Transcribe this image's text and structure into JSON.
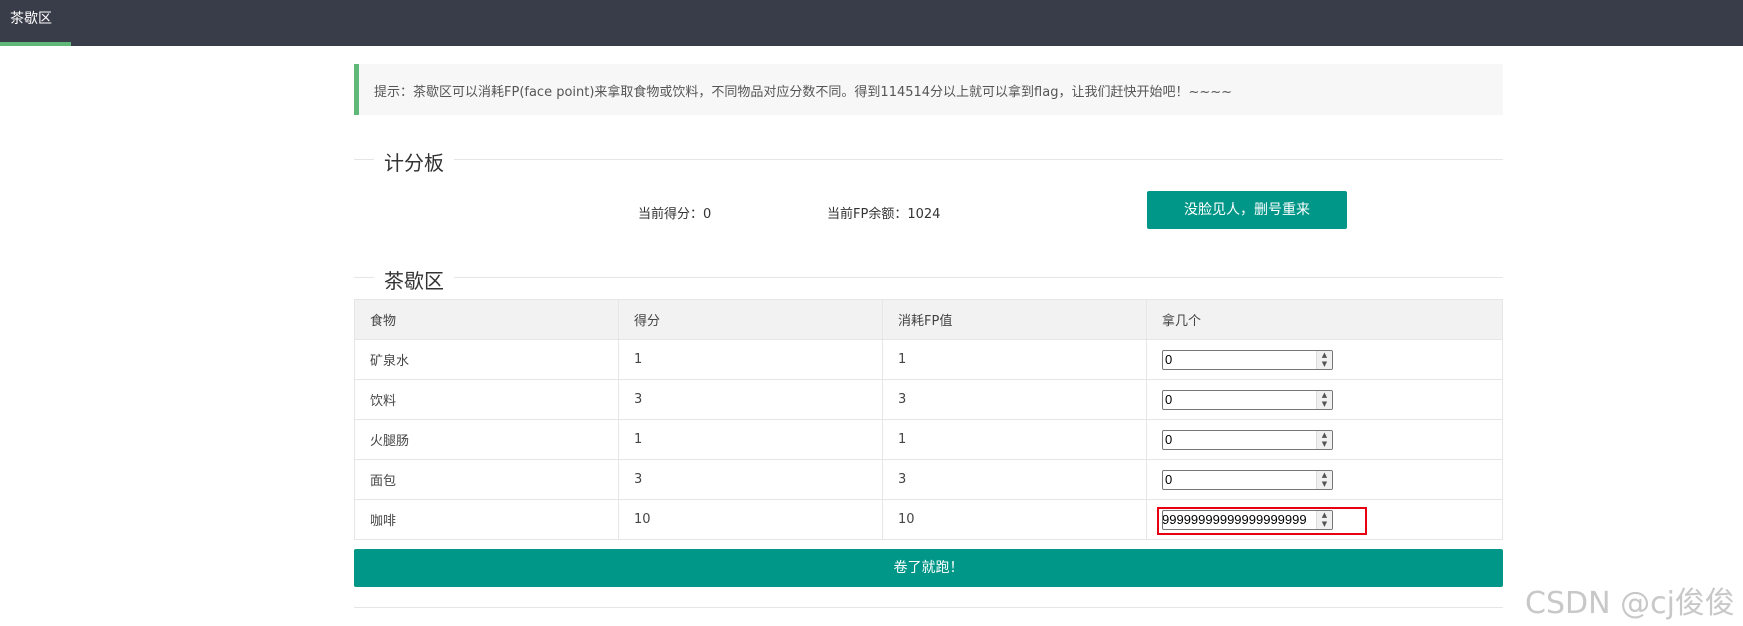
{
  "nav": {
    "tab_label": "茶歇区"
  },
  "tip": {
    "text": "提示：茶歇区可以消耗FP(face point)来拿取食物或饮料，不同物品对应分数不同。得到114514分以上就可以拿到flag，让我们赶快开始吧！~~~~"
  },
  "scoreboard": {
    "legend": "计分板",
    "score_label": "当前得分：0",
    "fp_label": "当前FP余额：1024",
    "reset_button": "没脸见人，删号重来"
  },
  "tea_break": {
    "legend": "茶歇区",
    "headers": [
      "食物",
      "得分",
      "消耗FP值",
      "拿几个"
    ],
    "rows": [
      {
        "food": "矿泉水",
        "score": "1",
        "fp": "1",
        "qty": "0"
      },
      {
        "food": "饮料",
        "score": "3",
        "fp": "3",
        "qty": "0"
      },
      {
        "food": "火腿肠",
        "score": "1",
        "fp": "1",
        "qty": "0"
      },
      {
        "food": "面包",
        "score": "3",
        "fp": "3",
        "qty": "0"
      },
      {
        "food": "咖啡",
        "score": "10",
        "fp": "10",
        "qty": "99999999999999999999"
      }
    ]
  },
  "submit_button": "卷了就跑！",
  "watermark": "CSDN @cj俊俊",
  "colors": {
    "topbar": "#393d49",
    "accent_green": "#5fb878",
    "button_teal": "#009688",
    "highlight_red": "#e60012"
  }
}
